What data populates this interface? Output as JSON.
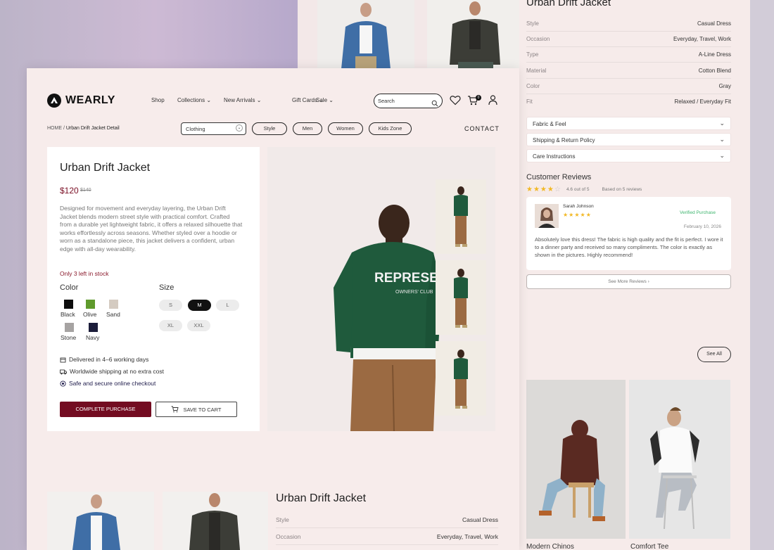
{
  "brand": {
    "name": "WEARLY"
  },
  "nav": {
    "items": [
      "Shop",
      "Collections",
      "New Arrivals",
      "Gift Cards",
      "Sale"
    ]
  },
  "search": {
    "placeholder": "Search"
  },
  "cart": {
    "count": "0"
  },
  "breadcrumb": {
    "home": "HOME /",
    "current": "Urban Drift Jacket Detail"
  },
  "filters": {
    "category_select": "Clothing",
    "chips": [
      "Style",
      "Men",
      "Women",
      "Kids Zone"
    ]
  },
  "contact": "CONTACT",
  "product": {
    "title": "Urban Drift Jacket",
    "price": "$120",
    "old_price": "$140",
    "description": "Designed for movement and everyday layering, the Urban Drift Jacket blends modern street style with practical comfort. Crafted from a durable yet lightweight fabric, it offers a relaxed silhouette that works effortlessly across seasons. Whether styled over a hoodie or worn as a standalone piece, this jacket delivers a confident, urban edge with all-day wearability.",
    "stock": "Only 3 left in stock",
    "color_heading": "Color",
    "colors": [
      {
        "name": "Black",
        "hex": "#0d0d0d"
      },
      {
        "name": "Olive",
        "hex": "#5f9a2c"
      },
      {
        "name": "Sand",
        "hex": "#d4cbc1"
      },
      {
        "name": "Stone",
        "hex": "#a6a3a2"
      },
      {
        "name": "Navy",
        "hex": "#1c1d3a"
      }
    ],
    "size_heading": "Size",
    "sizes": [
      "S",
      "M",
      "L",
      "XL",
      "XXL"
    ],
    "selected_size": "M",
    "features": [
      "Delivered in 4–6 working days",
      "Worldwide shipping at no extra cost",
      "Safe and secure online checkout"
    ],
    "buy_label": "COMPLETE PURCHASE",
    "cart_label": "SAVE TO CART"
  },
  "specs": [
    {
      "k": "Style",
      "v": "Casual Dress"
    },
    {
      "k": "Occasion",
      "v": "Everyday, Travel, Work"
    },
    {
      "k": "Type",
      "v": "A-Line Dress"
    },
    {
      "k": "Material",
      "v": "Cotton Blend"
    },
    {
      "k": "Color",
      "v": "Gray"
    },
    {
      "k": "Fit",
      "v": "Relaxed / Everyday Fit"
    }
  ],
  "accordions": [
    "Fabric & Feel",
    "Shipping & Return Policy",
    "Care Instructions"
  ],
  "reviews": {
    "title": "Customer Reviews",
    "rating_text": "4.6 out of 5",
    "count_text": "Based on 5 reviews",
    "review": {
      "name": "Sarah Johnson",
      "badge": "Verified Purchase",
      "date": "February 10, 2026",
      "text": "Absolutely love this dress! The fabric is high quality and the fit is perfect. I wore it to a dinner party and received so many compliments. The color is exactly as shown in the pictures. Highly recommend!"
    },
    "see_more": "See More Reviews",
    "see_all": "See All"
  },
  "related": [
    {
      "name": "Modern Chinos"
    },
    {
      "name": "Comfort Tee"
    }
  ],
  "colors": {
    "accent": "#730c21",
    "panel": "#f7eceb",
    "star": "#f2b824",
    "verified": "#3db46d"
  }
}
